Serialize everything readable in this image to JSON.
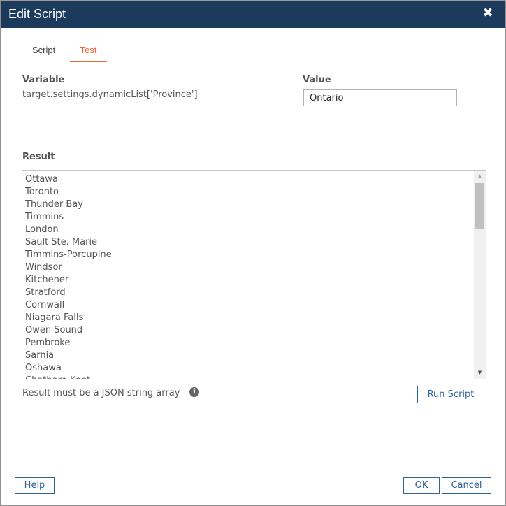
{
  "dialog": {
    "title": "Edit Script",
    "close_icon": "close-icon"
  },
  "tabs": [
    {
      "label": "Script",
      "active": false
    },
    {
      "label": "Test",
      "active": true
    }
  ],
  "variable": {
    "label": "Variable",
    "value": "target.settings.dynamicList['Province']"
  },
  "value_field": {
    "label": "Value",
    "value": "Ontario"
  },
  "result": {
    "label": "Result",
    "items": [
      "Ottawa",
      "Toronto",
      "Thunder Bay",
      "Timmins",
      "London",
      "Sault Ste. Marie",
      "Timmins-Porcupine",
      "Windsor",
      "Kitchener",
      "Stratford",
      "Cornwall",
      "Niagara Falls",
      "Owen Sound",
      "Pembroke",
      "Sarnia",
      "Oshawa",
      "Chatham-Kent"
    ],
    "hint": "Result must be a JSON string array",
    "hint_icon": "info-icon"
  },
  "buttons": {
    "run_script": "Run Script",
    "help": "Help",
    "ok": "OK",
    "cancel": "Cancel"
  },
  "colors": {
    "titlebar": "#1b3a5c",
    "active_tab": "#ea6a3a",
    "button_border": "#2b6496"
  }
}
